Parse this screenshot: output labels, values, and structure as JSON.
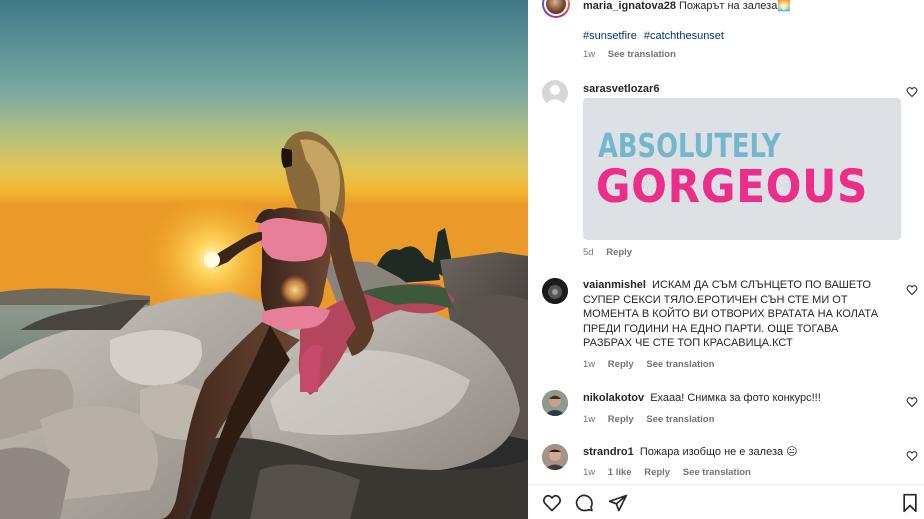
{
  "post": {
    "username": "maria_ignatova28",
    "caption": "Пожарът на залеза",
    "caption_emoji": "🌅",
    "hashtags": [
      "#sunsetfire",
      "#catchthesunset"
    ],
    "time": "1w",
    "see_translation": "See translation"
  },
  "comments": [
    {
      "username": "sarasvetlozar6",
      "text": "",
      "gif": {
        "line1": "ABSOLUTELY",
        "line2": "GORGEOUS"
      },
      "time": "5d",
      "reply": "Reply"
    },
    {
      "username": "vaianmishel",
      "text": "ИСКАМ ДА СЪМ СЛЪНЦЕТО ПО ВАШЕТО СУПЕР СЕКСИ ТЯЛО.ЕРОТИЧЕН СЪН СТЕ МИ ОТ МОМЕНТА В КОЙТО ВИ ОТВОРИХ ВРАТАТА НА КОЛАТА ПРЕДИ ГОДИНИ НА ЕДНО ПАРТИ. ОЩЕ ТОГАВА РАЗБРАХ ЧЕ СТЕ ТОП КРАСАВИЦА.КСТ",
      "time": "1w",
      "reply": "Reply",
      "see_translation": "See translation"
    },
    {
      "username": "nikolakotov",
      "text": "Ехааа! Снимка за фото конкурс!!!",
      "time": "1w",
      "reply": "Reply",
      "see_translation": "See translation"
    },
    {
      "username": "strandro1",
      "text": "Пожара изобщо не е залеза",
      "emoji": "😐",
      "time": "1w",
      "likes": "1 like",
      "reply": "Reply",
      "see_translation": "See translation"
    }
  ],
  "icons": {
    "like": "heart-icon",
    "comment": "comment-icon",
    "share": "share-icon",
    "save": "bookmark-icon",
    "comment_like": "heart-outline-icon"
  },
  "colors": {
    "link": "#00376b",
    "meta": "#737373",
    "gif_blue": "#74b7cd",
    "gif_pink": "#ec2e8a"
  }
}
